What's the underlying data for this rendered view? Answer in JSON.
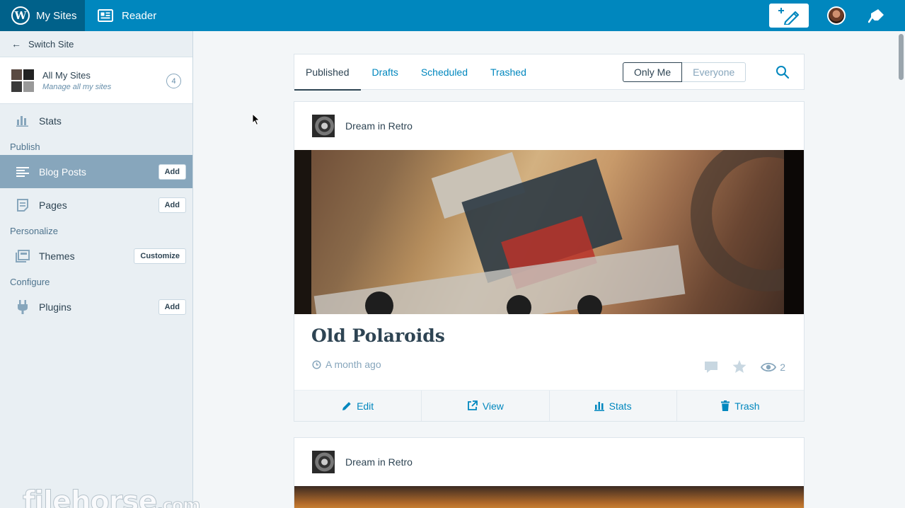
{
  "topbar": {
    "my_sites_label": "My Sites",
    "reader_label": "Reader",
    "brand_color": "#0087be",
    "my_sites_bg": "#00618a"
  },
  "sidebar": {
    "switch_site": "Switch Site",
    "all_sites": {
      "title": "All My Sites",
      "subtitle": "Manage all my sites",
      "count": "4"
    },
    "stats_label": "Stats",
    "sections": {
      "publish": "Publish",
      "personalize": "Personalize",
      "configure": "Configure"
    },
    "items": {
      "blog_posts": {
        "label": "Blog Posts",
        "button": "Add"
      },
      "pages": {
        "label": "Pages",
        "button": "Add"
      },
      "themes": {
        "label": "Themes",
        "button": "Customize"
      },
      "plugins": {
        "label": "Plugins",
        "button": "Add"
      }
    },
    "active_color": "#87a6bc"
  },
  "posts_nav": {
    "tabs": [
      "Published",
      "Drafts",
      "Scheduled",
      "Trashed"
    ],
    "filter": {
      "only_me": "Only Me",
      "everyone": "Everyone"
    }
  },
  "posts": [
    {
      "site_name": "Dream in Retro",
      "title": "Old Polaroids",
      "time": "A month ago",
      "views": "2",
      "actions": {
        "edit": "Edit",
        "view": "View",
        "stats": "Stats",
        "trash": "Trash"
      }
    },
    {
      "site_name": "Dream in Retro"
    }
  ],
  "watermark": {
    "main": "filehorse",
    "suffix": ".com"
  }
}
